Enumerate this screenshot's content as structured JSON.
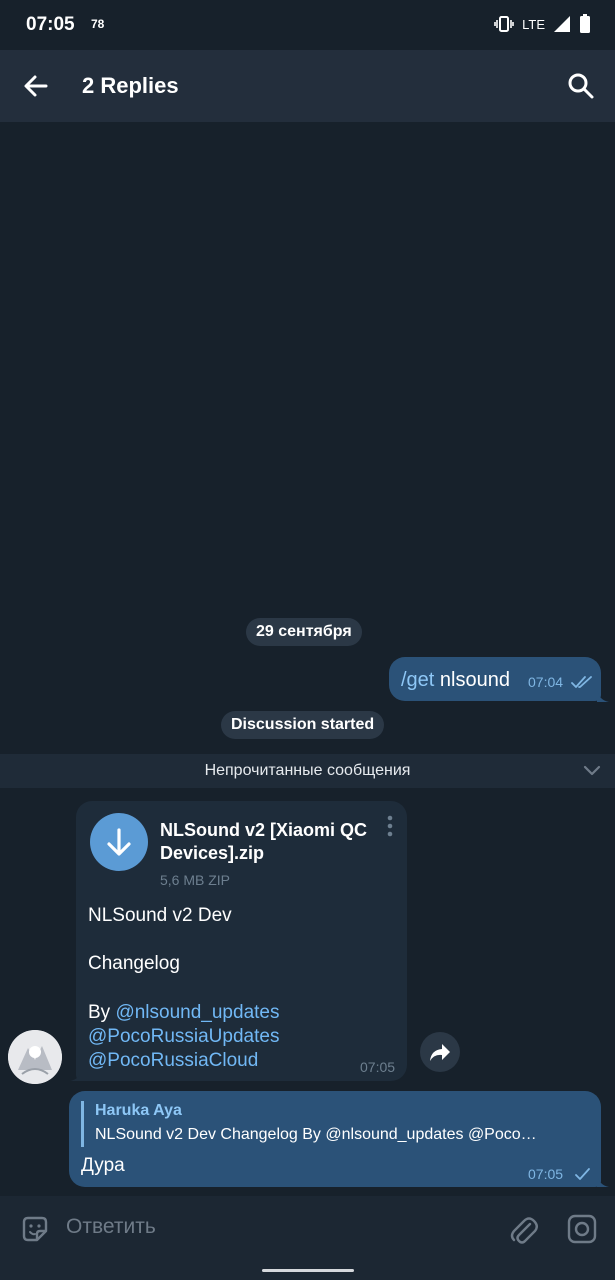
{
  "status_bar": {
    "time": "07:05",
    "notification_count": "78",
    "network": "LTE"
  },
  "header": {
    "title": "2 Replies",
    "back_icon": "arrow-left-icon",
    "search_icon": "search-icon"
  },
  "chat": {
    "date_separator": "29 сентября",
    "outgoing_message": {
      "command": "/get",
      "text": " nlsound",
      "time": "07:04",
      "status": "read"
    },
    "system_message": "Discussion started",
    "unread_label": "Непрочитанные сообщения",
    "file_message": {
      "file_name": "NLSound v2 [Xiaomi QC Devices].zip",
      "file_meta": "5,6 MB ZIP",
      "line1": "NLSound v2 Dev",
      "line2": "Changelog",
      "by_label": "By ",
      "links": [
        "@nlsound_updates",
        "@PocoRussiaUpdates",
        "@PocoRussiaCloud"
      ],
      "time": "07:05"
    },
    "reply_message": {
      "quoted_author": "Haruka Aya",
      "quoted_text": "NLSound v2 Dev  Changelog  By @nlsound_updates @Poco…",
      "text": "Дура",
      "time": "07:05",
      "status": "sent"
    }
  },
  "composer": {
    "placeholder": "Ответить"
  },
  "colors": {
    "background": "#17212b",
    "header": "#232e3c",
    "outgoing": "#2b5278",
    "incoming": "#1e2c3a",
    "link": "#71b8f5",
    "accent": "#5b9bd5"
  }
}
